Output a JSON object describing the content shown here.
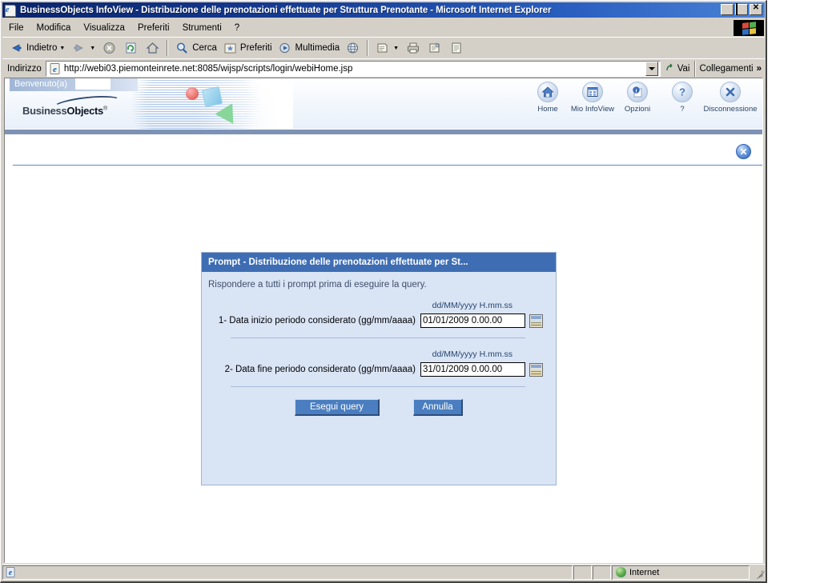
{
  "window": {
    "title": "BusinessObjects InfoView - Distribuzione delle prenotazioni effettuate per Struttura Prenotante - Microsoft Internet Explorer",
    "title_icon": "ie-page-icon",
    "minimize_label": "_",
    "maximize_label": "□",
    "close_label": "✕"
  },
  "menu": {
    "items": [
      {
        "label": "File",
        "name": "menu-file"
      },
      {
        "label": "Modifica",
        "name": "menu-modifica"
      },
      {
        "label": "Visualizza",
        "name": "menu-visualizza"
      },
      {
        "label": "Preferiti",
        "name": "menu-preferiti"
      },
      {
        "label": "Strumenti",
        "name": "menu-strumenti"
      },
      {
        "label": "?",
        "name": "menu-help"
      }
    ]
  },
  "toolbar": {
    "back_label": "Indietro",
    "search_label": "Cerca",
    "favorites_label": "Preferiti",
    "media_label": "Multimedia"
  },
  "address": {
    "label": "Indirizzo",
    "url": "http://webi03.piemonteinrete.net:8085/wijsp/scripts/login/webiHome.jsp",
    "go_label": "Vai",
    "links_label": "Collegamenti",
    "links_chevron": "»"
  },
  "banner": {
    "welcome": "Benvenuto(a)",
    "logo_first": "Business",
    "logo_second": "Objects",
    "logo_reg": "®",
    "nav": [
      {
        "label": "Home",
        "name": "nav-home",
        "icon": "home-icon"
      },
      {
        "label": "Mio InfoView",
        "name": "nav-mio-infoview",
        "icon": "grid-panel-icon"
      },
      {
        "label": "Opzioni",
        "name": "nav-opzioni",
        "icon": "info-icon"
      },
      {
        "label": "?",
        "name": "nav-help",
        "icon": "question-icon"
      },
      {
        "label": "Disconnessione",
        "name": "nav-disconnessione",
        "icon": "logout-x-icon"
      }
    ]
  },
  "content": {
    "close_icon_label": "✕"
  },
  "dialog": {
    "title": "Prompt - Distribuzione delle prenotazioni effettuate per St...",
    "subtitle": "Rispondere a tutti i prompt prima di eseguire la query.",
    "prompts": [
      {
        "format_hint": "dd/MM/yyyy H.mm.ss",
        "label": "1- Data inizio periodo considerato (gg/mm/aaaa)",
        "value": "01/01/2009 0.00.00",
        "calendar_icon": "calendar-icon"
      },
      {
        "format_hint": "dd/MM/yyyy H.mm.ss",
        "label": "2- Data fine periodo considerato (gg/mm/aaaa)",
        "value": "31/01/2009 0.00.00",
        "calendar_icon": "calendar-icon"
      }
    ],
    "run_label": "Esegui query",
    "cancel_label": "Annulla"
  },
  "statusbar": {
    "message": "",
    "zone": "Internet"
  },
  "colors": {
    "title_bar_start": "#0a246a",
    "title_bar_end": "#4a83d6",
    "chrome": "#d4d0c8",
    "dialog_header": "#3e6db3",
    "dialog_body": "#d9e4f5",
    "button_blue": "#4a7ec0",
    "banner_bar": "#7e92b5",
    "rule_blue": "#5f87c3"
  }
}
